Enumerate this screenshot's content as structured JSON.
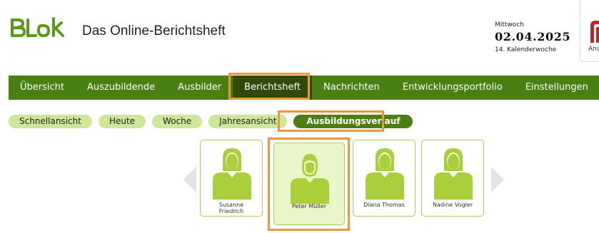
{
  "header": {
    "logo_text": "BLok",
    "app_title": "Das Online-Berichtsheft",
    "weekday": "Mittwoch",
    "date": "02.04.2025",
    "week": "14. Kalenderwoche",
    "corner_label": "And"
  },
  "nav": {
    "items": [
      {
        "label": "Übersicht",
        "active": false
      },
      {
        "label": "Auszubildende",
        "active": false
      },
      {
        "label": "Ausbilder",
        "active": false
      },
      {
        "label": "Berichtsheft",
        "active": true
      },
      {
        "label": "Nachrichten",
        "active": false
      },
      {
        "label": "Entwicklungsportfolio",
        "active": false
      },
      {
        "label": "Einstellungen",
        "active": false
      }
    ]
  },
  "subnav": {
    "items": [
      {
        "label": "Schnellansicht",
        "active": false
      },
      {
        "label": "Heute",
        "active": false
      },
      {
        "label": "Woche",
        "active": false
      },
      {
        "label": "Jahresansicht",
        "active": false
      },
      {
        "label": "Ausbildungsverlauf",
        "active": true
      }
    ]
  },
  "trainees": [
    {
      "name_line1": "Susanne",
      "name_line2": "Friedrich",
      "selected": false
    },
    {
      "name_line1": "Peter Müller",
      "name_line2": "",
      "selected": true
    },
    {
      "name_line1": "Diana Thomas",
      "name_line2": "",
      "selected": false
    },
    {
      "name_line1": "Nadine Vogler",
      "name_line2": "",
      "selected": false
    }
  ],
  "colors": {
    "nav_bg": "#4a7f12",
    "nav_active_bg": "#2e4b0a",
    "pill_bg": "#cde69a",
    "avatar": "#a9cf3a",
    "highlight": "#f0963a",
    "logo": "#5a9a1a",
    "corner_red": "#c0262d"
  },
  "icons": {
    "carousel_prev": "chevron-left-icon",
    "carousel_next": "chevron-right-icon",
    "avatar": "female-user-icon / male-user-icon"
  }
}
